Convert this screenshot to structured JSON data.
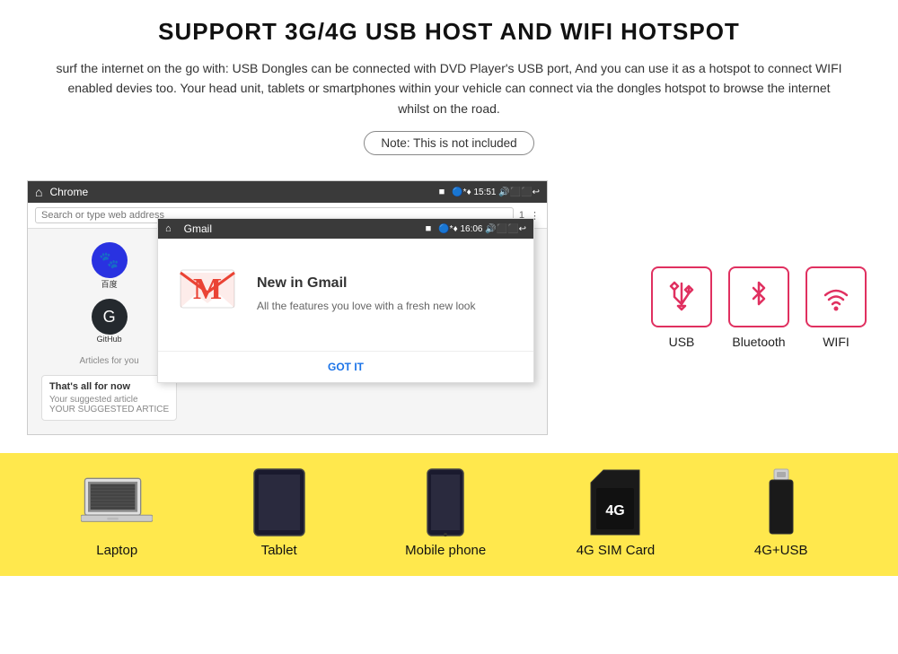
{
  "page": {
    "title": "SUPPORT 3G/4G USB HOST AND WIFI HOTSPOT",
    "description": "surf the internet on the go with: USB Dongles can be connected with DVD Player's USB port, And you can use it as a hotspot to connect WIFI enabled devies too. Your head unit, tablets or smartphones within your vehicle can connect via the dongles hotspot to browse the internet whilst on the road.",
    "note": "Note: This is not included"
  },
  "browser": {
    "app_name": "Chrome",
    "status_bar": "🔵 * ◆ ♦  15:51  🔊 ⬛ ⬛ ↩",
    "address_placeholder": "Search or type web address"
  },
  "gmail_overlay": {
    "app_name": "Gmail",
    "status_bar": "🔵 * ◆ ♦  16:06  🔊 ⬛ ⬛ ↩",
    "title": "New in Gmail",
    "body": "All the features you love with a fresh new look",
    "button": "GOT IT"
  },
  "sidebar_apps": [
    {
      "name": "百度",
      "label": "百度"
    },
    {
      "name": "GitHub",
      "label": "GitHub"
    }
  ],
  "browser_content": {
    "articles_label": "Articles for you",
    "suggestion_title": "That's all for now",
    "suggestion_body": "Your suggested article..."
  },
  "connectivity": {
    "items": [
      {
        "id": "usb",
        "label": "USB"
      },
      {
        "id": "bluetooth",
        "label": "Bluetooth"
      },
      {
        "id": "wifi",
        "label": "WIFI"
      }
    ]
  },
  "devices": [
    {
      "id": "laptop",
      "label": "Laptop"
    },
    {
      "id": "tablet",
      "label": "Tablet"
    },
    {
      "id": "mobile-phone",
      "label": "Mobile phone"
    },
    {
      "id": "4g-sim",
      "label": "4G SIM Card",
      "badge": "4G"
    },
    {
      "id": "4g-usb",
      "label": "4G+USB"
    }
  ]
}
